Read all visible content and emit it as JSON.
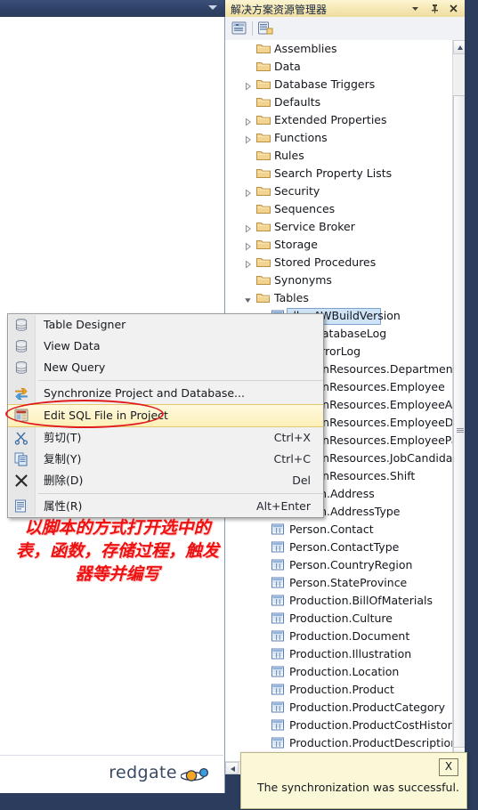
{
  "left_panel": {
    "titlebar_icon": "chevron-down-icon",
    "footer_brand": "redgate",
    "footer_icon": "planet-logo-icon"
  },
  "solution_explorer": {
    "title": "解决方案资源管理器",
    "title_buttons": [
      {
        "name": "chevron-down-icon",
        "glyph": "▼"
      },
      {
        "name": "pin-icon",
        "glyph": "⍑"
      },
      {
        "name": "close-icon",
        "glyph": "✕"
      }
    ],
    "toolbar": [
      {
        "name": "properties-window-icon"
      },
      {
        "name": "show-all-files-icon"
      }
    ],
    "tree": [
      {
        "label": "Assemblies",
        "indent": 0,
        "expander": "none",
        "icon": "folder-icon"
      },
      {
        "label": "Data",
        "indent": 0,
        "expander": "none",
        "icon": "folder-icon"
      },
      {
        "label": "Database Triggers",
        "indent": 0,
        "expander": "closed",
        "icon": "folder-icon"
      },
      {
        "label": "Defaults",
        "indent": 0,
        "expander": "none",
        "icon": "folder-icon"
      },
      {
        "label": "Extended Properties",
        "indent": 0,
        "expander": "closed",
        "icon": "folder-icon"
      },
      {
        "label": "Functions",
        "indent": 0,
        "expander": "closed",
        "icon": "folder-icon"
      },
      {
        "label": "Rules",
        "indent": 0,
        "expander": "none",
        "icon": "folder-icon"
      },
      {
        "label": "Search Property Lists",
        "indent": 0,
        "expander": "none",
        "icon": "folder-icon"
      },
      {
        "label": "Security",
        "indent": 0,
        "expander": "closed",
        "icon": "folder-icon"
      },
      {
        "label": "Sequences",
        "indent": 0,
        "expander": "none",
        "icon": "folder-icon"
      },
      {
        "label": "Service Broker",
        "indent": 0,
        "expander": "closed",
        "icon": "folder-icon"
      },
      {
        "label": "Storage",
        "indent": 0,
        "expander": "closed",
        "icon": "folder-icon"
      },
      {
        "label": "Stored Procedures",
        "indent": 0,
        "expander": "closed",
        "icon": "folder-icon"
      },
      {
        "label": "Synonyms",
        "indent": 0,
        "expander": "none",
        "icon": "folder-icon"
      },
      {
        "label": "Tables",
        "indent": 0,
        "expander": "open",
        "icon": "folder-open-icon"
      },
      {
        "label": "dbo.AWBuildVersion",
        "indent": 1,
        "expander": "none",
        "icon": "table-icon",
        "selected": true
      },
      {
        "label": "dbo.DatabaseLog",
        "indent": 1,
        "expander": "none",
        "icon": "table-icon"
      },
      {
        "label": "dbo.ErrorLog",
        "indent": 1,
        "expander": "none",
        "icon": "table-icon"
      },
      {
        "label": "HumanResources.Department",
        "indent": 1,
        "expander": "none",
        "icon": "table-icon"
      },
      {
        "label": "HumanResources.Employee",
        "indent": 1,
        "expander": "none",
        "icon": "table-icon"
      },
      {
        "label": "HumanResources.EmployeeAddress",
        "indent": 1,
        "expander": "none",
        "icon": "table-icon"
      },
      {
        "label": "HumanResources.EmployeeDepartmentHistory",
        "indent": 1,
        "expander": "none",
        "icon": "table-icon"
      },
      {
        "label": "HumanResources.EmployeePayHistory",
        "indent": 1,
        "expander": "none",
        "icon": "table-icon"
      },
      {
        "label": "HumanResources.JobCandidate",
        "indent": 1,
        "expander": "none",
        "icon": "table-icon"
      },
      {
        "label": "HumanResources.Shift",
        "indent": 1,
        "expander": "none",
        "icon": "table-icon"
      },
      {
        "label": "Person.Address",
        "indent": 1,
        "expander": "none",
        "icon": "table-icon"
      },
      {
        "label": "Person.AddressType",
        "indent": 1,
        "expander": "none",
        "icon": "table-icon"
      },
      {
        "label": "Person.Contact",
        "indent": 1,
        "expander": "none",
        "icon": "table-icon"
      },
      {
        "label": "Person.ContactType",
        "indent": 1,
        "expander": "none",
        "icon": "table-icon"
      },
      {
        "label": "Person.CountryRegion",
        "indent": 1,
        "expander": "none",
        "icon": "table-icon"
      },
      {
        "label": "Person.StateProvince",
        "indent": 1,
        "expander": "none",
        "icon": "table-icon"
      },
      {
        "label": "Production.BillOfMaterials",
        "indent": 1,
        "expander": "none",
        "icon": "table-icon"
      },
      {
        "label": "Production.Culture",
        "indent": 1,
        "expander": "none",
        "icon": "table-icon"
      },
      {
        "label": "Production.Document",
        "indent": 1,
        "expander": "none",
        "icon": "table-icon"
      },
      {
        "label": "Production.Illustration",
        "indent": 1,
        "expander": "none",
        "icon": "table-icon"
      },
      {
        "label": "Production.Location",
        "indent": 1,
        "expander": "none",
        "icon": "table-icon"
      },
      {
        "label": "Production.Product",
        "indent": 1,
        "expander": "none",
        "icon": "table-icon"
      },
      {
        "label": "Production.ProductCategory",
        "indent": 1,
        "expander": "none",
        "icon": "table-icon"
      },
      {
        "label": "Production.ProductCostHistory",
        "indent": 1,
        "expander": "none",
        "icon": "table-icon"
      },
      {
        "label": "Production.ProductDescription",
        "indent": 1,
        "expander": "none",
        "icon": "table-icon"
      }
    ]
  },
  "context_menu": {
    "items": [
      {
        "label": "Table Designer",
        "shortcut": "",
        "icon": "database-icon",
        "type": "item"
      },
      {
        "label": "View Data",
        "shortcut": "",
        "icon": "database-icon",
        "type": "item"
      },
      {
        "label": "New Query",
        "shortcut": "",
        "icon": "database-icon",
        "type": "item"
      },
      {
        "type": "separator"
      },
      {
        "label": "Synchronize Project and Database...",
        "shortcut": "",
        "icon": "sync-icon",
        "type": "item"
      },
      {
        "label": "Edit SQL File in Project",
        "shortcut": "",
        "icon": "sql-file-icon",
        "type": "item",
        "highlighted": true
      },
      {
        "label": "剪切(T)",
        "shortcut": "Ctrl+X",
        "icon": "scissors-icon",
        "type": "item"
      },
      {
        "label": "复制(Y)",
        "shortcut": "Ctrl+C",
        "icon": "copy-icon",
        "type": "item"
      },
      {
        "label": "删除(D)",
        "shortcut": "Del",
        "icon": "delete-x-icon",
        "type": "item"
      },
      {
        "type": "separator"
      },
      {
        "label": "属性(R)",
        "shortcut": "Alt+Enter",
        "icon": "properties-icon",
        "type": "item"
      }
    ]
  },
  "annotation": {
    "text": "以脚本的方式打开选中的表，函数，存储过程，触发器等并编写",
    "color": "#ee1111",
    "ellipse_target": "Edit SQL File in Project"
  },
  "toast": {
    "message": "The synchronization was successful.",
    "close_label": "X"
  }
}
